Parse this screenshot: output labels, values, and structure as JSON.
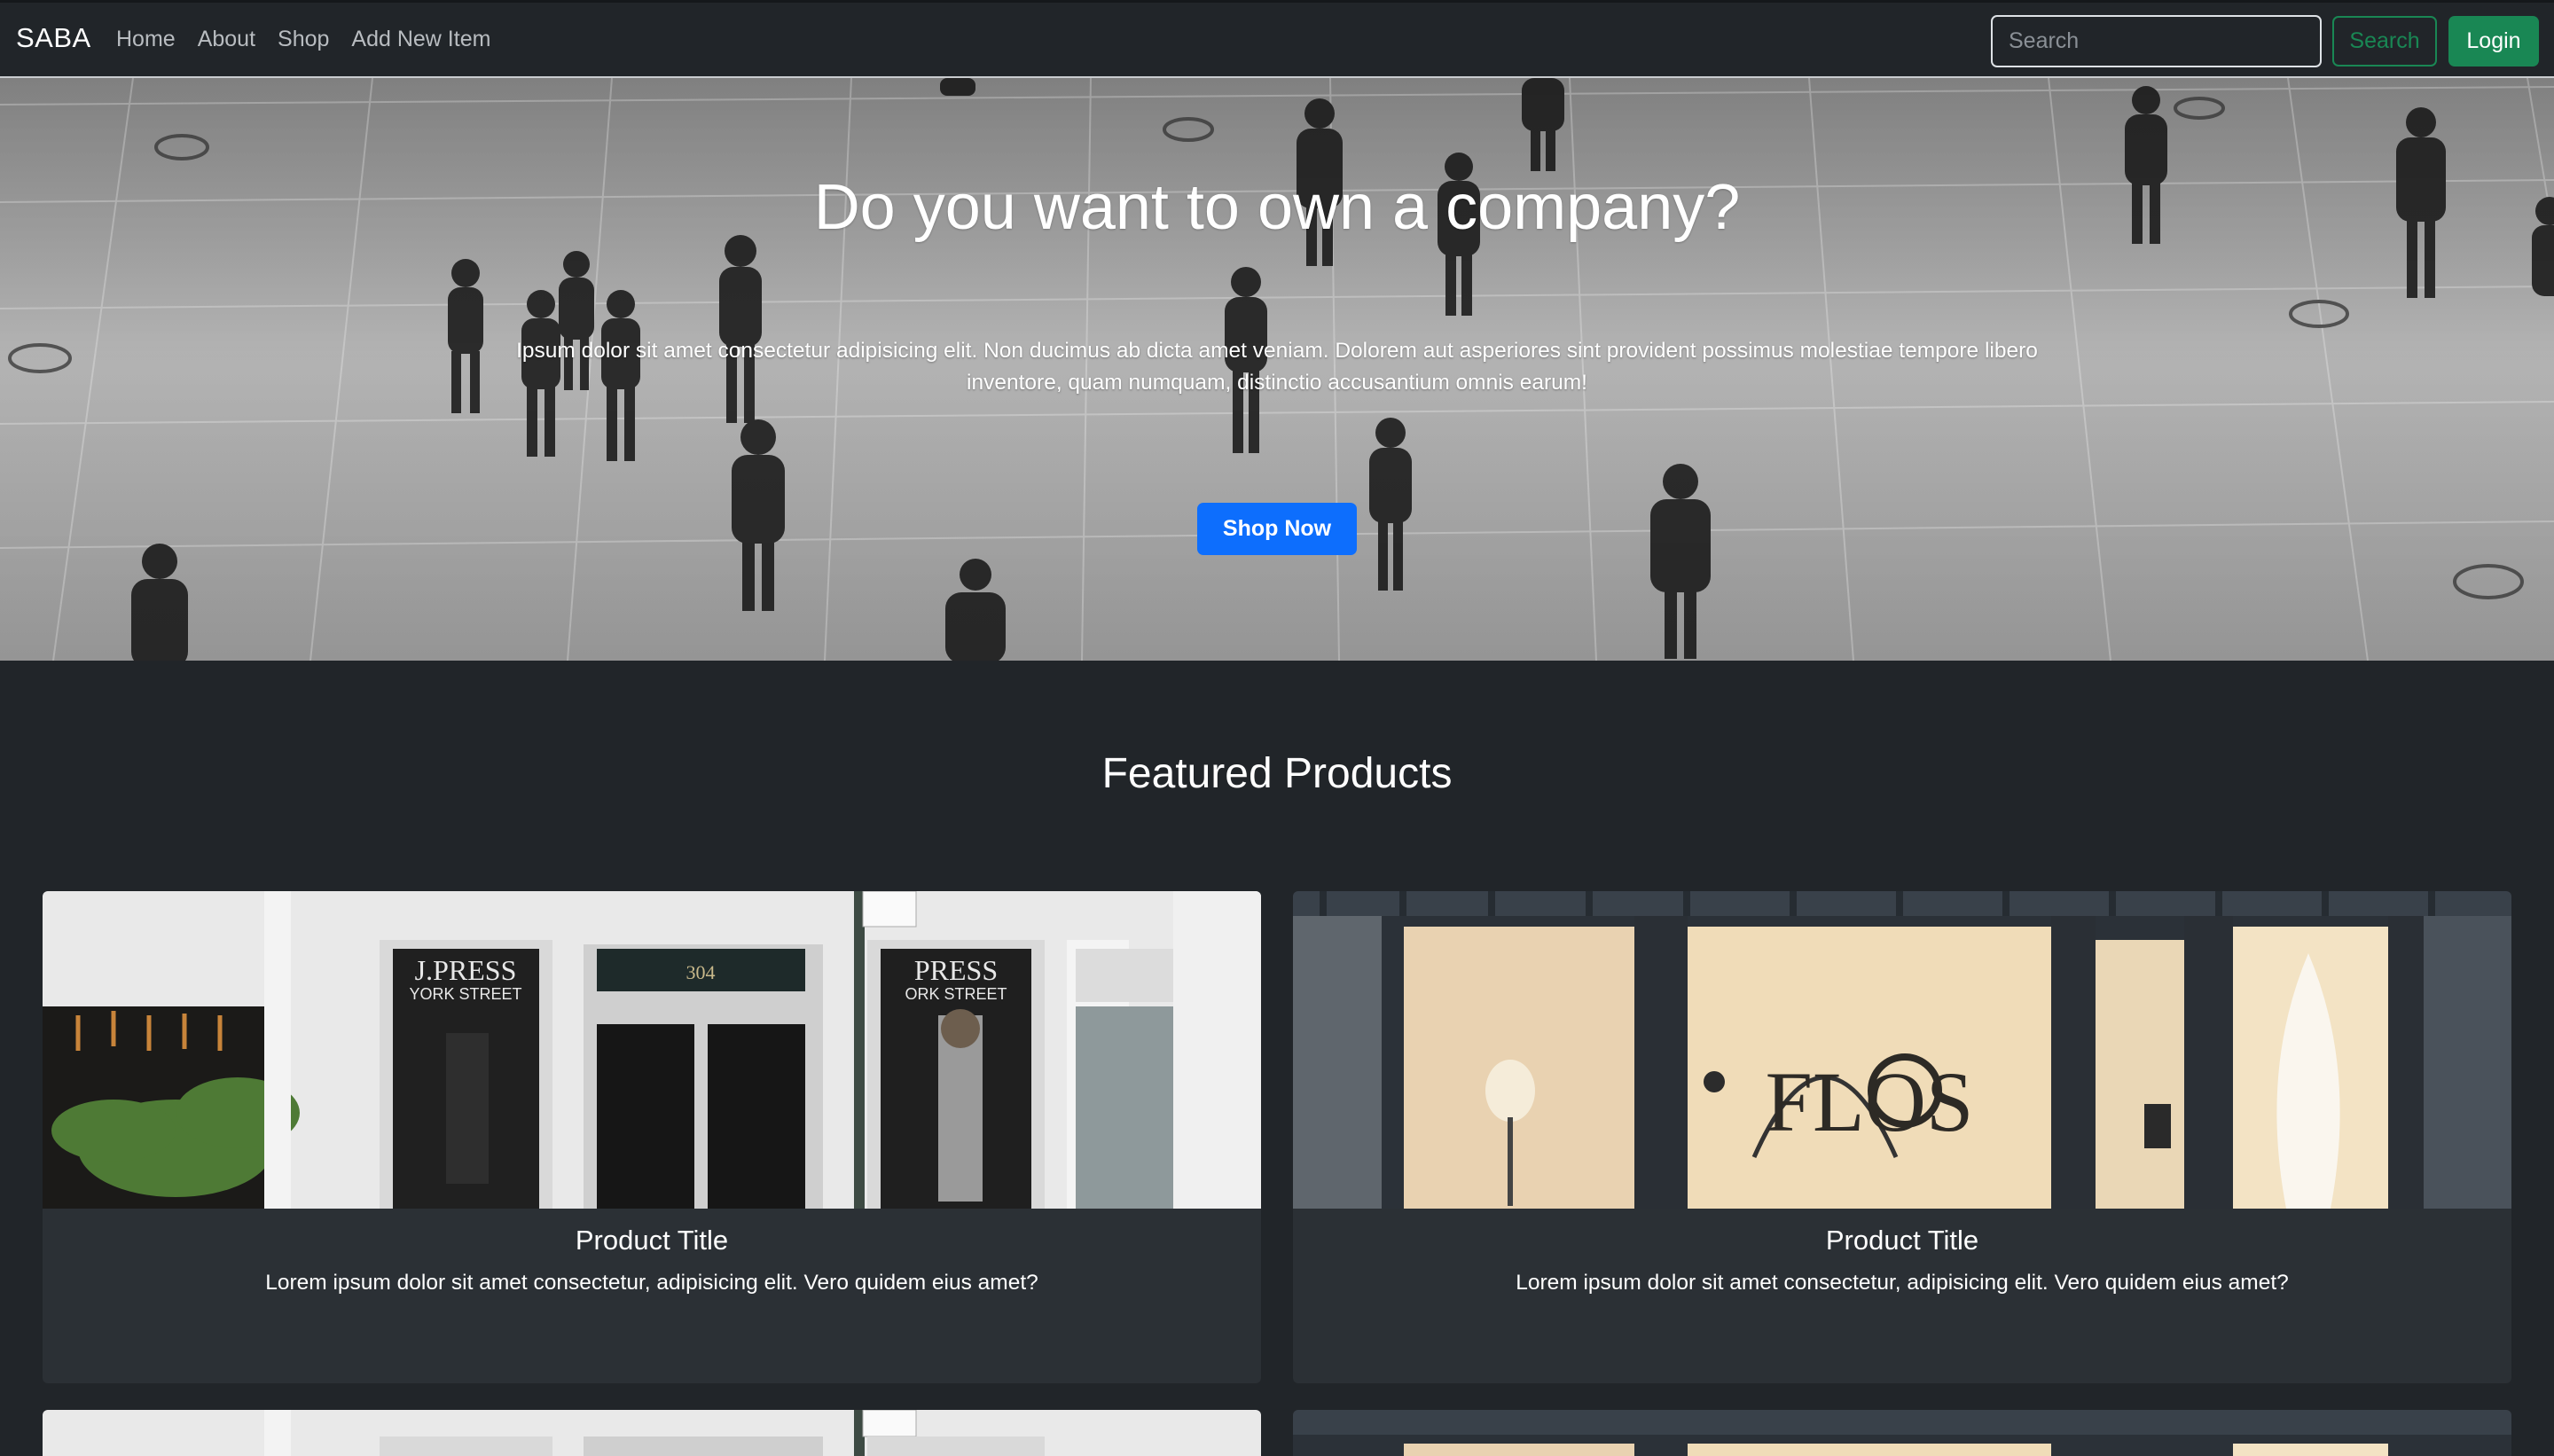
{
  "navbar": {
    "brand": "SABA",
    "links": [
      "Home",
      "About",
      "Shop",
      "Add New Item"
    ],
    "search_placeholder": "Search",
    "search_button": "Search",
    "login_button": "Login"
  },
  "hero": {
    "title": "Do you want to own a company?",
    "text": "Ipsum dolor sit amet consectetur adipisicing elit. Non ducimus ab dicta amet veniam. Dolorem aut asperiores sint provident possimus molestiae tempore libero inventore, quam numquam, distinctio accusantium omnis earum!",
    "cta": "Shop Now"
  },
  "featured": {
    "heading": "Featured Products",
    "products": [
      {
        "title": "Product Title",
        "description": "Lorem ipsum dolor sit amet consectetur, adipisicing elit. Vero quidem eius amet?",
        "image": "storefront-jpress"
      },
      {
        "title": "Product Title",
        "description": "Lorem ipsum dolor sit amet consectetur, adipisicing elit. Vero quidem eius amet?",
        "image": "storefront-flos"
      }
    ]
  },
  "storefront_signs": {
    "jpress_left": "J.PRESS",
    "jpress_left_sub": "YORK STREET",
    "number": "304",
    "jpress_right": "PRESS",
    "jpress_right_sub": "ORK STREET",
    "flos": "FLOS"
  },
  "colors": {
    "navbar_bg": "#212529",
    "page_bg": "#212529",
    "card_bg": "#2b3035",
    "primary": "#0d6efd",
    "success": "#198754"
  }
}
